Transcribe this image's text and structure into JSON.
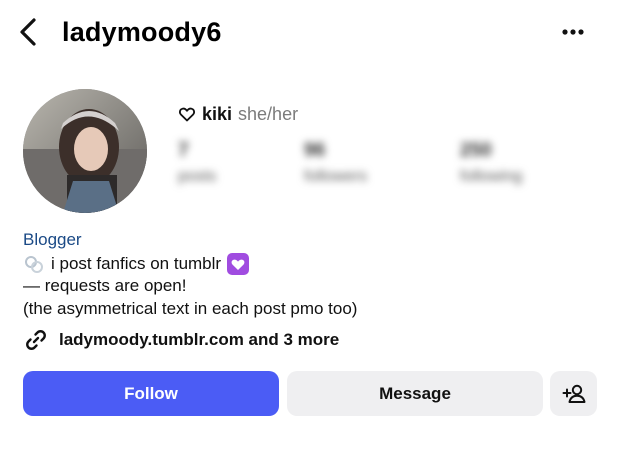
{
  "header": {
    "username": "ladymoody6"
  },
  "profile": {
    "display_name": "kiki",
    "pronouns": "she/her",
    "stats": [
      {
        "value": "7",
        "label": "posts"
      },
      {
        "value": "96",
        "label": "followers"
      },
      {
        "value": "250",
        "label": "following"
      }
    ],
    "category": "Blogger",
    "bio": {
      "line1": "i post fanfics on tumblr",
      "line2": "— requests are open!",
      "line3": "(the asymmetrical text in each post pmo too)"
    },
    "link_text": "ladymoody.tumblr.com and 3 more"
  },
  "actions": {
    "follow_label": "Follow",
    "message_label": "Message"
  },
  "colors": {
    "follow_button": "#4b5cf5",
    "secondary_button": "#efeff1",
    "category_text": "#1b4a86",
    "pronoun_text": "#7b7b7b"
  },
  "icons": [
    "back-arrow-icon",
    "more-icon",
    "heart-outline-icon",
    "rings-emoji-icon",
    "purple-heart-emoji-icon",
    "link-icon",
    "add-user-icon"
  ]
}
